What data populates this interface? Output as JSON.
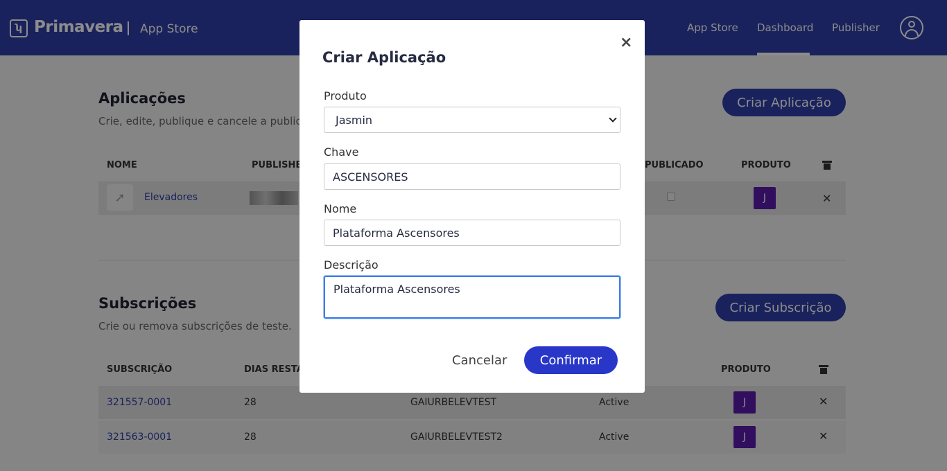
{
  "header": {
    "logo_glyph": "ʮ",
    "brand": "Primavera",
    "sub": "App Store",
    "nav": [
      "App Store",
      "Dashboard",
      "Publisher"
    ],
    "active_nav": "Dashboard"
  },
  "apps": {
    "title": "Aplicações",
    "subtitle": "Crie, edite, publique e cancele a publicação",
    "create_button": "Criar Aplicação",
    "columns": [
      "NOME",
      "PUBLISHER",
      "PUBLICADO",
      "PRODUTO"
    ],
    "rows": [
      {
        "name": "Elevadores",
        "published": false
      }
    ]
  },
  "subs": {
    "title": "Subscrições",
    "subtitle": "Crie ou remova subscrições de teste.",
    "create_button": "Criar Subscrição",
    "columns": [
      "SUBSCRIÇÃO",
      "DIAS RESTAN",
      "PRODUTO"
    ],
    "rows": [
      {
        "id": "321557-0001",
        "days": "28",
        "tenant": "GAIURBELEVTEST",
        "status": "Active"
      },
      {
        "id": "321563-0001",
        "days": "28",
        "tenant": "GAIURBELEVTEST2",
        "status": "Active"
      }
    ]
  },
  "modal": {
    "title": "Criar Aplicação",
    "close": "×",
    "produto_label": "Produto",
    "produto_value": "Jasmin",
    "chave_label": "Chave",
    "chave_value": "ASCENSORES",
    "nome_label": "Nome",
    "nome_value": "Plataforma Ascensores",
    "descricao_label": "Descrição",
    "descricao_value": "Plataforma Ascensores",
    "cancel": "Cancelar",
    "confirm": "Confirmar"
  },
  "icons": {
    "product_glyph": "J",
    "remove_glyph": "✕",
    "rocket_glyph": "➚"
  },
  "colors": {
    "header": "#2f3ea8",
    "primary": "#2937c9",
    "product_badge": "#5b1cab"
  }
}
